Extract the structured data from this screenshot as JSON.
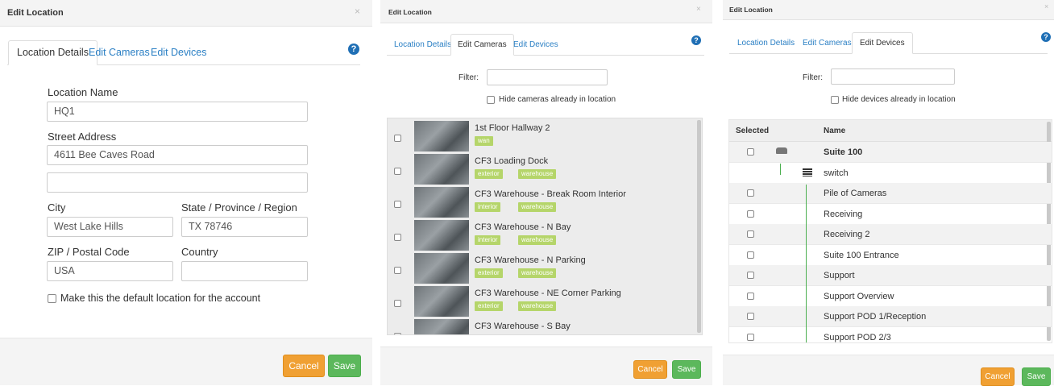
{
  "panel1": {
    "title": "Edit Location",
    "close": "×",
    "tabs": [
      "Location Details",
      "Edit Cameras",
      "Edit Devices"
    ],
    "help": "?",
    "location_name_label": "Location Name",
    "location_name_value": "HQ1",
    "street_label": "Street Address",
    "street_value": "4611 Bee Caves Road",
    "street2_value": "",
    "city_label": "City",
    "city_value": "West Lake Hills",
    "state_label": "State / Province / Region",
    "state_value": "TX 78746",
    "zip_label": "ZIP / Postal Code",
    "zip_value": "USA",
    "country_label": "Country",
    "country_value": "",
    "default_checkbox_label": "Make this the default location for the account",
    "cancel": "Cancel",
    "save": "Save"
  },
  "panel2": {
    "title": "Edit Location",
    "close": "×",
    "tabs": [
      "Location Details",
      "Edit Cameras",
      "Edit Devices"
    ],
    "help": "?",
    "filter_label": "Filter:",
    "hide_label": "Hide cameras already in location",
    "cameras": [
      {
        "name": "1st Floor Hallway 2",
        "tags": [
          "wan"
        ]
      },
      {
        "name": "CF3 Loading Dock",
        "tags": [
          "exterior",
          "warehouse"
        ]
      },
      {
        "name": "CF3 Warehouse - Break Room Interior",
        "tags": [
          "interior",
          "warehouse"
        ]
      },
      {
        "name": "CF3 Warehouse - N Bay",
        "tags": [
          "interior",
          "warehouse"
        ]
      },
      {
        "name": "CF3 Warehouse - N Parking",
        "tags": [
          "exterior",
          "warehouse"
        ]
      },
      {
        "name": "CF3 Warehouse - NE Corner Parking",
        "tags": [
          "exterior",
          "warehouse"
        ]
      },
      {
        "name": "CF3 Warehouse - S Bay",
        "tags": []
      }
    ],
    "cancel": "Cancel",
    "save": "Save"
  },
  "panel3": {
    "title": "Edit Location",
    "close": "×",
    "tabs": [
      "Location Details",
      "Edit Cameras",
      "Edit Devices"
    ],
    "help": "?",
    "filter_label": "Filter:",
    "hide_label": "Hide devices already in location",
    "col_selected": "Selected",
    "col_name": "Name",
    "devices": [
      {
        "name": "Suite 100",
        "bold": true,
        "icon": "dvr-icon",
        "checkbox": true
      },
      {
        "name": "switch",
        "bold": false,
        "icon": "switch-icon",
        "checkbox": false
      },
      {
        "name": "Pile of Cameras",
        "checkbox": true
      },
      {
        "name": "Receiving",
        "checkbox": true
      },
      {
        "name": "Receiving 2",
        "checkbox": true
      },
      {
        "name": "Suite 100 Entrance",
        "checkbox": true
      },
      {
        "name": "Support",
        "checkbox": true
      },
      {
        "name": "Support Overview",
        "checkbox": true
      },
      {
        "name": "Support POD 1/Reception",
        "checkbox": true
      },
      {
        "name": "Support POD 2/3",
        "checkbox": true
      }
    ],
    "cancel": "Cancel",
    "save": "Save"
  }
}
